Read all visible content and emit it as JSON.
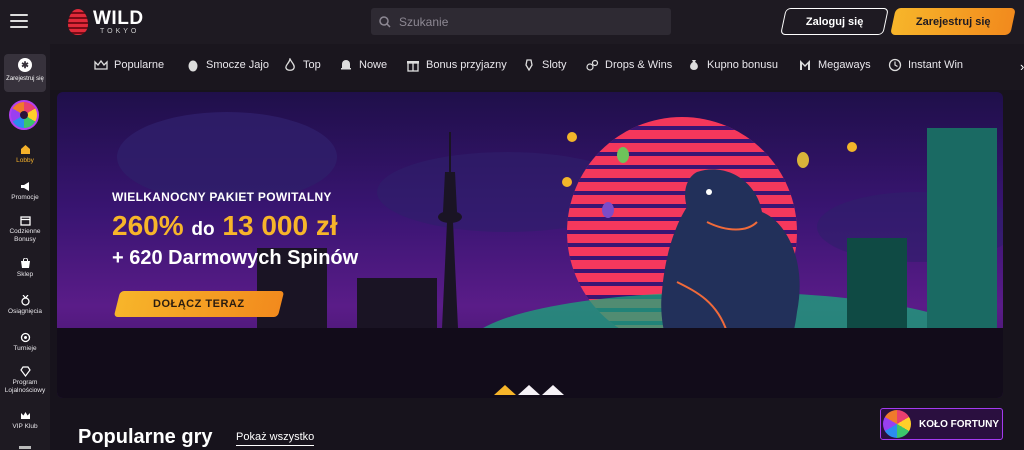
{
  "header": {
    "logo_main": "WILD",
    "logo_sub": "TOKYO",
    "search_placeholder": "Szukanie",
    "login_label": "Zaloguj się",
    "register_label": "Zarejestruj się"
  },
  "sidebar": {
    "register_label": "Zarejestruj się",
    "items": [
      {
        "label": "Lobby",
        "icon": "home-icon",
        "active": true
      },
      {
        "label": "Promocje",
        "icon": "megaphone-icon"
      },
      {
        "label": "Codzienne Bonusy",
        "icon": "calendar-gift-icon"
      },
      {
        "label": "Sklep",
        "icon": "shop-icon"
      },
      {
        "label": "Osiągnięcia",
        "icon": "medal-icon"
      },
      {
        "label": "Turnieje",
        "icon": "tournament-icon"
      },
      {
        "label": "Program Lojalnościowy",
        "icon": "diamond-icon"
      },
      {
        "label": "VIP Klub",
        "icon": "crown-icon"
      }
    ]
  },
  "categories": [
    {
      "label": "Popularne",
      "icon": "crown-icon"
    },
    {
      "label": "Smocze Jajo",
      "icon": "egg-icon"
    },
    {
      "label": "Top",
      "icon": "flame-icon"
    },
    {
      "label": "Nowe",
      "icon": "bell-icon"
    },
    {
      "label": "Bonus przyjazny",
      "icon": "gift-icon"
    },
    {
      "label": "Sloty",
      "icon": "slot-icon"
    },
    {
      "label": "Drops & Wins",
      "icon": "drops-icon"
    },
    {
      "label": "Kupno bonusu",
      "icon": "moneybag-icon"
    },
    {
      "label": "Megaways",
      "icon": "megaways-icon"
    },
    {
      "label": "Instant Win",
      "icon": "instant-icon"
    }
  ],
  "banner": {
    "subtitle": "WIELKANOCNY PAKIET POWITALNY",
    "main_percent": "260%",
    "main_mid": "do",
    "main_amount": "13 000 zł",
    "spins": "+ 620 Darmowych Spinów",
    "cta": "DOŁĄCZ TERAZ"
  },
  "section": {
    "title": "Popularne gry",
    "show_all": "Pokaż wszystko"
  },
  "wheel_widget": {
    "label": "KOŁO FORTUNY"
  },
  "colors": {
    "accent": "#f7b52a",
    "background": "#17131c",
    "sidebar": "#1e1a22"
  }
}
